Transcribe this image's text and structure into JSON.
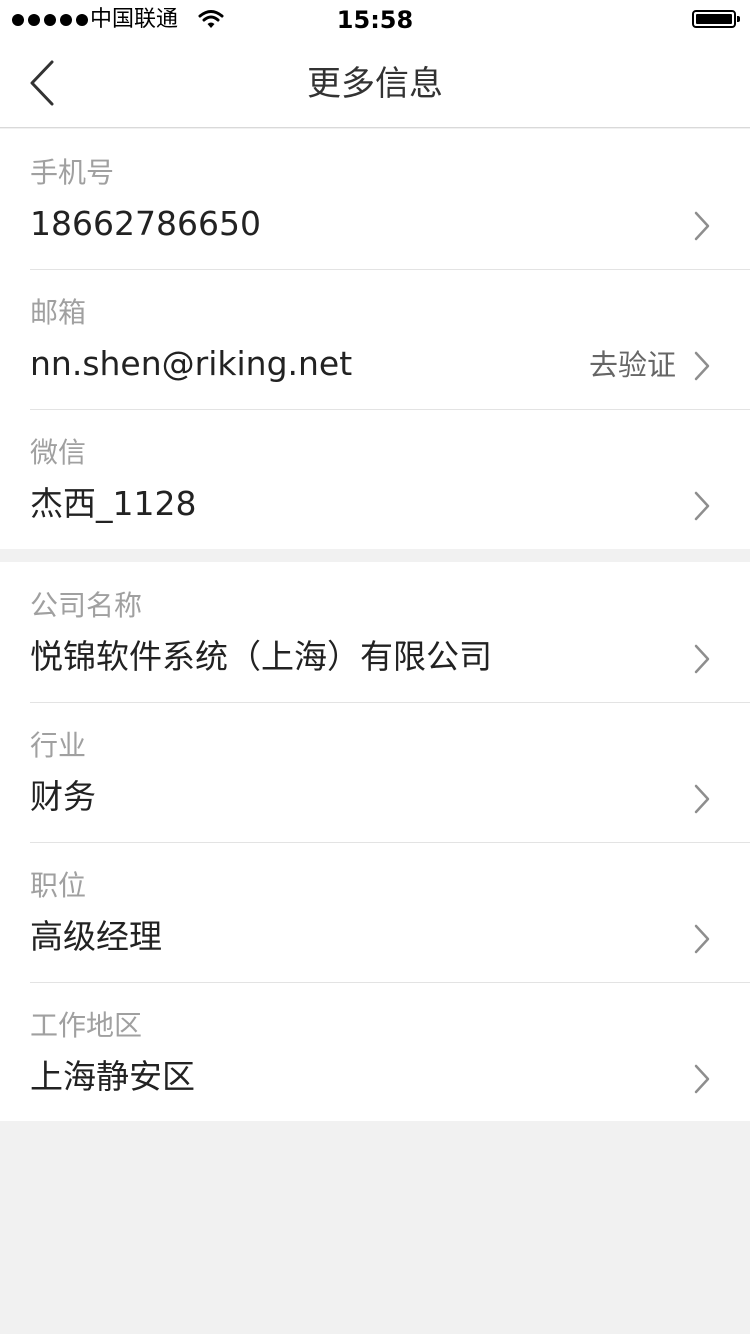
{
  "status_bar": {
    "carrier": "中国联通",
    "time": "15:58"
  },
  "nav": {
    "title": "更多信息"
  },
  "groups": [
    {
      "rows": [
        {
          "label": "手机号",
          "value": "18662786650",
          "action": ""
        },
        {
          "label": "邮箱",
          "value": "nn.shen@riking.net",
          "action": "去验证"
        },
        {
          "label": "微信",
          "value": "杰西_1128",
          "action": ""
        }
      ]
    },
    {
      "rows": [
        {
          "label": "公司名称",
          "value": "悦锦软件系统（上海）有限公司",
          "action": ""
        },
        {
          "label": "行业",
          "value": "财务",
          "action": ""
        },
        {
          "label": "职位",
          "value": "高级经理",
          "action": ""
        },
        {
          "label": "工作地区",
          "value": "上海静安区",
          "action": ""
        }
      ]
    }
  ],
  "icons": {
    "back": "back-arrow-icon",
    "chevron": "chevron-right-icon",
    "wifi": "wifi-icon",
    "battery": "battery-icon",
    "signal": "signal-dots-icon"
  },
  "colors": {
    "background": "#f1f1f1",
    "label": "#a0a0a0",
    "value": "#222222",
    "chevron": "#8e8e8e"
  }
}
